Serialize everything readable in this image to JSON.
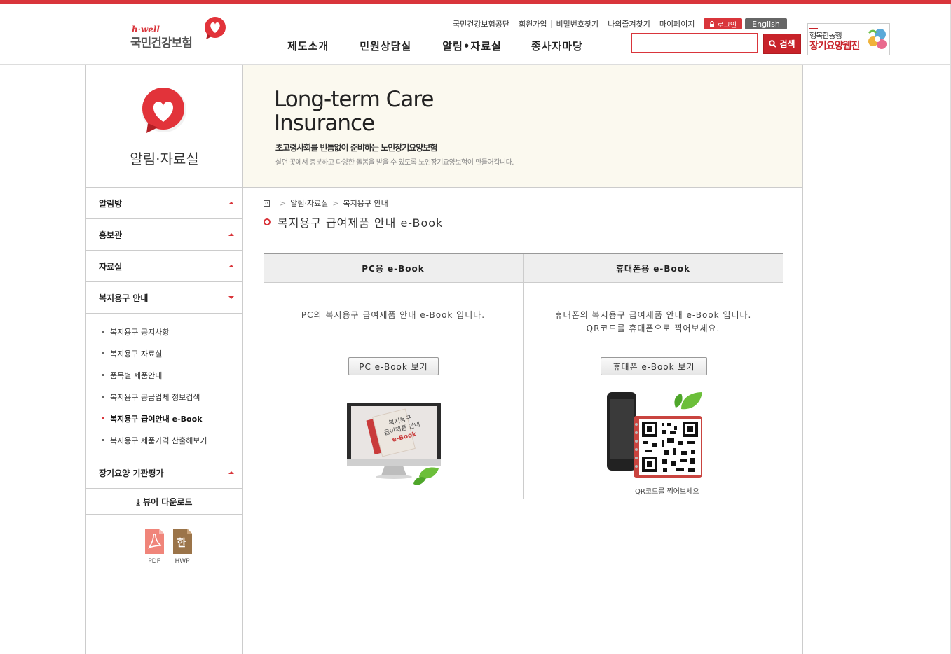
{
  "header": {
    "logo_brand": "h·well",
    "logo_name": "국민건강보험",
    "util_links": [
      "국민건강보험공단",
      "회원가입",
      "비밀번호찾기",
      "나의즐겨찾기",
      "마이페이지"
    ],
    "login_label": "로그인",
    "english_label": "English",
    "gnb": [
      "제도소개",
      "민원상담실",
      "알림•자료실",
      "종사자마당"
    ],
    "search": {
      "value": "",
      "button_label": "검색"
    },
    "banner": {
      "line1": "행복한동행",
      "line2": "장기요양웹진"
    }
  },
  "lnb": {
    "title": "알림·자료실",
    "menu": [
      {
        "label": "알림방"
      },
      {
        "label": "홍보관"
      },
      {
        "label": "자료실"
      },
      {
        "label": "복지용구 안내"
      }
    ],
    "submenu": [
      "복지용구 공지사항",
      "복지용구 자료실",
      "품목별 제품안내",
      "복지용구 공급업체 정보검색",
      "복지용구 급여안내 e-Book",
      "복지용구 제품가격 산출해보기"
    ],
    "menu_after": "장기요양 기관평가",
    "viewer_label": "⤓ 뷰어 다운로드",
    "downloads": [
      {
        "label": "PDF",
        "color": "#f0857a"
      },
      {
        "label": "HWP",
        "glyph": "한",
        "color": "#9b7449"
      }
    ]
  },
  "hero": {
    "title_line1": "Long-term Care",
    "title_line2": "Insurance",
    "subtitle": "초고령사회를 빈틈없이 준비하는 노인장기요양보험",
    "description": "살던 곳에서 충분하고 다양한 돌봄을 받을 수 있도록 노인장기요양보험이 만들어갑니다."
  },
  "breadcrumb": [
    "알림·자료실",
    "복지용구 안내"
  ],
  "page_title": "복지용구 급여제품 안내 e-Book",
  "ebook": {
    "pc": {
      "header": "PC용 e-Book",
      "description": "PC의 복지용구 급여제품 안내 e-Book 입니다.",
      "button": "PC e-Book 보기",
      "cover_lines": [
        "복지용구",
        "급여제품 안내",
        "e-Book"
      ]
    },
    "mobile": {
      "header": "휴대폰용 e-Book",
      "description_line1": "휴대폰의 복지용구 급여제품 안내 e-Book 입니다.",
      "description_line2": "QR코드를 휴대폰으로 찍어보세요.",
      "button": "휴대폰 e-Book 보기",
      "qr_caption": "QR코드를 찍어보세요"
    }
  },
  "colors": {
    "accent": "#d9353b",
    "hero_bg": "#fbf9ef"
  }
}
